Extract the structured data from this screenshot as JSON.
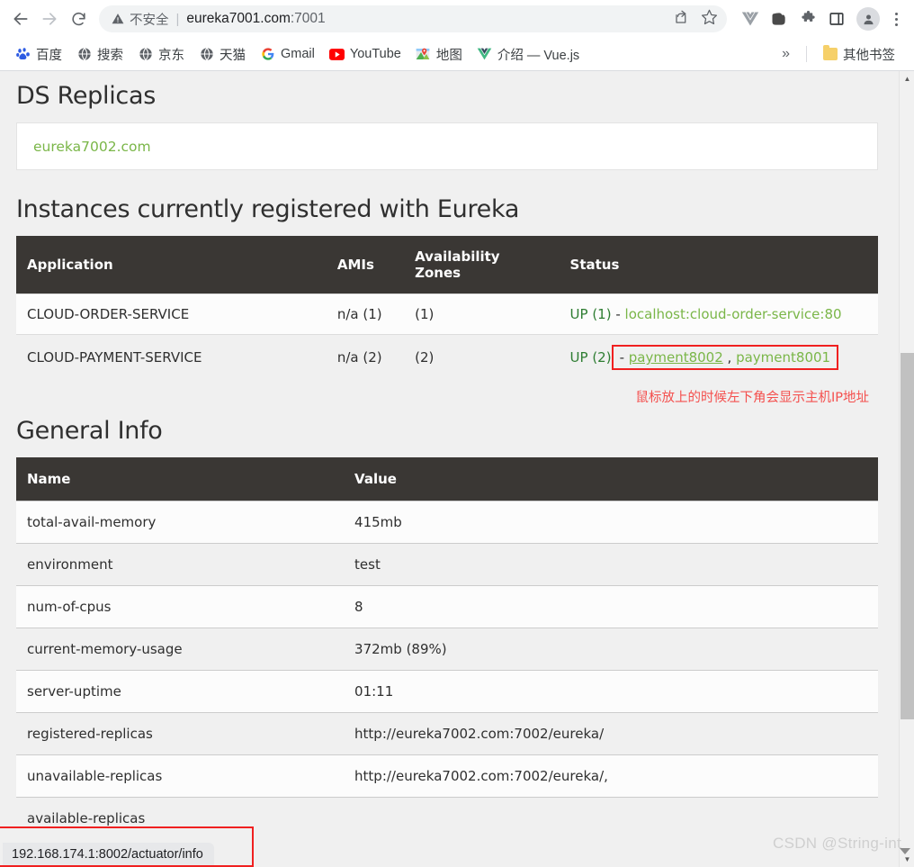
{
  "browser": {
    "nav": {
      "back_icon": "arrow-left-icon",
      "forward_icon": "arrow-right-icon",
      "reload_icon": "reload-icon"
    },
    "omnibox": {
      "security_warning_icon": "warning-triangle-icon",
      "security_label": "不安全",
      "url_host": "eureka7001.com",
      "url_port": ":7001",
      "share_icon": "share-icon",
      "bookmark_icon": "star-icon"
    },
    "extensions": [
      {
        "name": "vue-devtools-icon",
        "label": "V"
      },
      {
        "name": "evernote-icon",
        "label": ""
      },
      {
        "name": "puzzle-extensions-icon",
        "label": ""
      },
      {
        "name": "sidepanel-icon",
        "label": ""
      }
    ],
    "profile_icon": "profile-avatar-icon",
    "menu_icon": "three-dots-menu-icon",
    "bookmarks": [
      {
        "label": "百度",
        "icon": "baidu-icon"
      },
      {
        "label": "搜索",
        "icon": "globe-icon"
      },
      {
        "label": "京东",
        "icon": "globe-icon"
      },
      {
        "label": "天猫",
        "icon": "globe-icon"
      },
      {
        "label": "Gmail",
        "icon": "gmail-icon"
      },
      {
        "label": "YouTube",
        "icon": "youtube-icon"
      },
      {
        "label": "地图",
        "icon": "maps-icon"
      },
      {
        "label": "介绍 — Vue.js",
        "icon": "vue-icon"
      }
    ],
    "bookmarks_overflow_label": "»",
    "other_bookmarks_label": "其他书签",
    "other_bookmarks_icon": "folder-icon"
  },
  "page": {
    "ds_replicas": {
      "heading": "DS Replicas",
      "replicas": [
        {
          "label": "eureka7002.com"
        }
      ]
    },
    "instances": {
      "heading": "Instances currently registered with Eureka",
      "columns": [
        "Application",
        "AMIs",
        "Availability Zones",
        "Status"
      ],
      "rows": [
        {
          "application": "CLOUD-ORDER-SERVICE",
          "amis": "n/a (1)",
          "zones": "(1)",
          "status_prefix": "UP (1)",
          "status_dash": " - ",
          "links": [
            {
              "text": "localhost:cloud-order-service:80",
              "hovered": false
            }
          ],
          "highlighted": false
        },
        {
          "application": "CLOUD-PAYMENT-SERVICE",
          "amis": "n/a (2)",
          "zones": "(2)",
          "status_prefix": "UP (2)",
          "status_dash": " - ",
          "links": [
            {
              "text": "payment8002",
              "hovered": true
            },
            {
              "text": "payment8001",
              "hovered": false
            }
          ],
          "link_separator": " , ",
          "highlighted": true
        }
      ]
    },
    "annotation": "鼠标放上的时候左下角会显示主机IP地址",
    "general_info": {
      "heading": "General Info",
      "columns": [
        "Name",
        "Value"
      ],
      "rows": [
        {
          "name": "total-avail-memory",
          "value": "415mb"
        },
        {
          "name": "environment",
          "value": "test"
        },
        {
          "name": "num-of-cpus",
          "value": "8"
        },
        {
          "name": "current-memory-usage",
          "value": "372mb (89%)"
        },
        {
          "name": "server-uptime",
          "value": "01:11"
        },
        {
          "name": "registered-replicas",
          "value": "http://eureka7002.com:7002/eureka/"
        },
        {
          "name": "unavailable-replicas",
          "value": "http://eureka7002.com:7002/eureka/,"
        },
        {
          "name": "available-replicas",
          "value": ""
        }
      ]
    }
  },
  "status_bar": {
    "hovered_url": "192.168.174.1:8002/actuator/info"
  },
  "watermark": {
    "text": "CSDN @String-int"
  },
  "colors": {
    "table_header_bg": "#3a3734",
    "link_green": "#7ab648",
    "status_up_green": "#2e7d32",
    "highlight_red": "#f02020",
    "annotation_red": "#f4504e",
    "page_bg": "#f0f0f0"
  }
}
